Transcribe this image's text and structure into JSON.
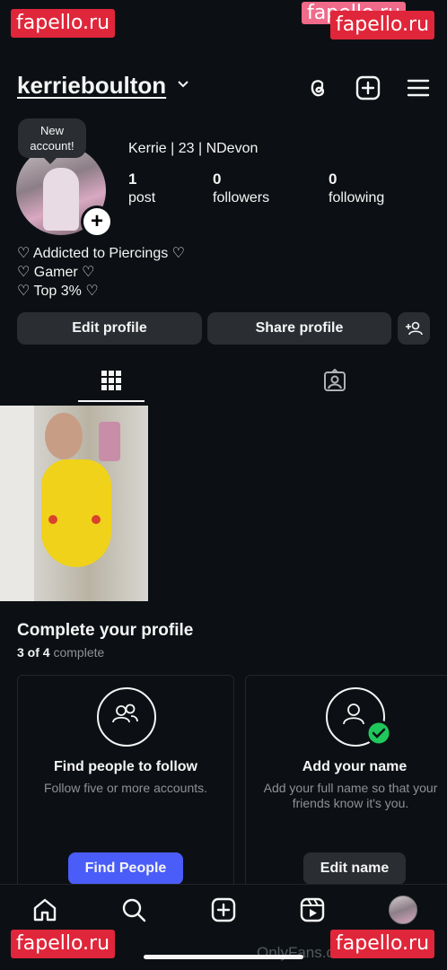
{
  "watermarks": [
    "fapello.ru",
    "fapello.ru",
    "fapello.ru",
    "fapello.ru"
  ],
  "watermark_partial": "fapello.ru",
  "status_bar": {
    "dots": "• • • •"
  },
  "header": {
    "username": "kerrieboulton",
    "icons": [
      "threads-icon",
      "create-icon",
      "menu-icon"
    ]
  },
  "profile": {
    "bubble_text": "New account!",
    "display_name": "Kerrie | 23 | NDevon",
    "stats": [
      {
        "value": "1",
        "label": "post"
      },
      {
        "value": "0",
        "label": "followers"
      },
      {
        "value": "0",
        "label": "following"
      }
    ],
    "bio": [
      "♡ Addicted to Piercings ♡",
      "♡ Gamer ♡",
      "♡ Top 3% ♡"
    ]
  },
  "actions": {
    "edit_profile": "Edit profile",
    "share_profile": "Share profile"
  },
  "tabs": [
    "grid-icon",
    "tagged-icon"
  ],
  "complete_profile": {
    "title": "Complete your profile",
    "progress_count": "3 of 4",
    "progress_word": "complete",
    "cards": [
      {
        "title": "Find people to follow",
        "desc": "Follow five or more accounts.",
        "button": "Find People",
        "button_color": "#4a5df9"
      },
      {
        "title": "Add your name",
        "desc": "Add your full name so that your friends know it's you.",
        "button": "Edit name",
        "button_color": "#2a2e33"
      }
    ]
  },
  "bottom_nav": [
    "home-icon",
    "search-icon",
    "create-icon",
    "reels-icon",
    "profile-avatar"
  ],
  "footer_text": "OnlyFans.com/kerrie"
}
